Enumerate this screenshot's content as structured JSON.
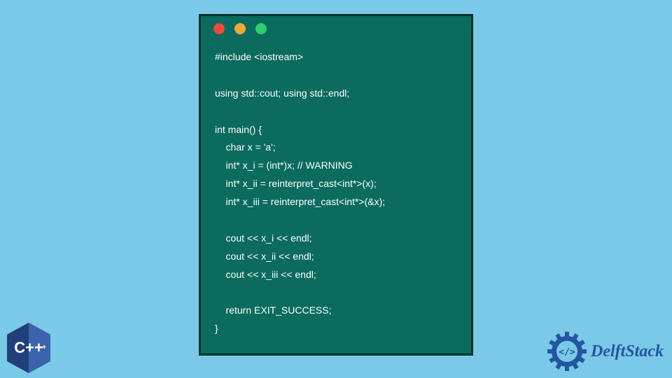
{
  "code": {
    "lines": [
      "#include <iostream>",
      "",
      "using std::cout; using std::endl;",
      "",
      "int main() {",
      "    char x = 'a';",
      "    int* x_i = (int*)x; // WARNING",
      "    int* x_ii = reinterpret_cast<int*>(x);",
      "    int* x_iii = reinterpret_cast<int*>(&x);",
      "",
      "    cout << x_i << endl;",
      "    cout << x_ii << endl;",
      "    cout << x_iii << endl;",
      "",
      "    return EXIT_SUCCESS;",
      "}"
    ]
  },
  "badges": {
    "cpp_label": "C++",
    "brand": "DelftStack"
  },
  "colors": {
    "bg": "#7ac9e8",
    "window": "#0a6b5e",
    "window_border": "#03322c",
    "text": "#ffffff",
    "brand": "#2455a3",
    "cpp_blue": "#2a4b8d"
  },
  "traffic_lights": [
    "red",
    "yellow",
    "green"
  ]
}
